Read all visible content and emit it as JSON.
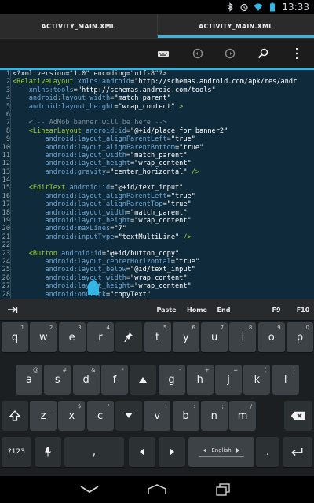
{
  "status": {
    "time": "13:33"
  },
  "tabs": [
    {
      "label": "ACTIVITY_MAIN.XML",
      "active": false
    },
    {
      "label": "ACTIVITY_MAIN.XML",
      "active": true
    }
  ],
  "code_lines": [
    {
      "n": "1",
      "segs": [
        [
          "norm",
          "<?xml version=\"1.0\" encoding=\"utf-8\"?>"
        ]
      ]
    },
    {
      "n": "2",
      "segs": [
        [
          "tag",
          "<RelativeLayout "
        ],
        [
          "attr",
          "xmlns:android"
        ],
        [
          "punc",
          "="
        ],
        [
          "str",
          "\"http://schemas.android.com/apk/res/andr"
        ]
      ]
    },
    {
      "n": "3",
      "segs": [
        [
          "norm",
          "    "
        ],
        [
          "attr",
          "xmlns:tools"
        ],
        [
          "punc",
          "="
        ],
        [
          "str",
          "\"http://schemas.android.com/tools\""
        ]
      ]
    },
    {
      "n": "4",
      "segs": [
        [
          "norm",
          "    "
        ],
        [
          "attr",
          "android:layout_width"
        ],
        [
          "punc",
          "="
        ],
        [
          "str",
          "\"match_parent\""
        ]
      ]
    },
    {
      "n": "5",
      "segs": [
        [
          "norm",
          "    "
        ],
        [
          "attr",
          "android:layout_height"
        ],
        [
          "punc",
          "="
        ],
        [
          "str",
          "\"wrap_content\""
        ],
        [
          "tag",
          " >"
        ]
      ]
    },
    {
      "n": "6",
      "segs": []
    },
    {
      "n": "7",
      "segs": [
        [
          "norm",
          "    "
        ],
        [
          "com",
          "<!-- AdMob banner will be here -->"
        ]
      ]
    },
    {
      "n": "8",
      "segs": [
        [
          "norm",
          "    "
        ],
        [
          "tag",
          "<LinearLayout "
        ],
        [
          "attr",
          "android:id"
        ],
        [
          "punc",
          "="
        ],
        [
          "str",
          "\"@+id/place_for_banner2\""
        ]
      ]
    },
    {
      "n": "9",
      "segs": [
        [
          "norm",
          "        "
        ],
        [
          "attr",
          "android:layout_alignParentLeft"
        ],
        [
          "punc",
          "="
        ],
        [
          "str",
          "\"true\""
        ]
      ]
    },
    {
      "n": "10",
      "segs": [
        [
          "norm",
          "        "
        ],
        [
          "attr",
          "android:layout_alignParentBottom"
        ],
        [
          "punc",
          "="
        ],
        [
          "str",
          "\"true\""
        ]
      ]
    },
    {
      "n": "11",
      "segs": [
        [
          "norm",
          "        "
        ],
        [
          "attr",
          "android:layout_width"
        ],
        [
          "punc",
          "="
        ],
        [
          "str",
          "\"match_parent\""
        ]
      ]
    },
    {
      "n": "12",
      "segs": [
        [
          "norm",
          "        "
        ],
        [
          "attr",
          "android:layout_height"
        ],
        [
          "punc",
          "="
        ],
        [
          "str",
          "\"wrap_content\""
        ]
      ]
    },
    {
      "n": "13",
      "segs": [
        [
          "norm",
          "        "
        ],
        [
          "attr",
          "android:gravity"
        ],
        [
          "punc",
          "="
        ],
        [
          "str",
          "\"center_horizontal\""
        ],
        [
          "tag",
          " />"
        ]
      ]
    },
    {
      "n": "14",
      "segs": []
    },
    {
      "n": "15",
      "segs": [
        [
          "norm",
          "    "
        ],
        [
          "tag",
          "<EditText "
        ],
        [
          "attr",
          "android:id"
        ],
        [
          "punc",
          "="
        ],
        [
          "str",
          "\"@+id/text_input\""
        ]
      ]
    },
    {
      "n": "16",
      "segs": [
        [
          "norm",
          "        "
        ],
        [
          "attr",
          "android:layout_alignParentLeft"
        ],
        [
          "punc",
          "="
        ],
        [
          "str",
          "\"true\""
        ]
      ]
    },
    {
      "n": "17",
      "segs": [
        [
          "norm",
          "        "
        ],
        [
          "attr",
          "android:layout_alignParentTop"
        ],
        [
          "punc",
          "="
        ],
        [
          "str",
          "\"true\""
        ]
      ]
    },
    {
      "n": "18",
      "segs": [
        [
          "norm",
          "        "
        ],
        [
          "attr",
          "android:layout_width"
        ],
        [
          "punc",
          "="
        ],
        [
          "str",
          "\"match_parent\""
        ]
      ]
    },
    {
      "n": "19",
      "segs": [
        [
          "norm",
          "        "
        ],
        [
          "attr",
          "android:layout_height"
        ],
        [
          "punc",
          "="
        ],
        [
          "str",
          "\"wrap_content\""
        ]
      ]
    },
    {
      "n": "20",
      "segs": [
        [
          "norm",
          "        "
        ],
        [
          "attr",
          "android:maxLines"
        ],
        [
          "punc",
          "="
        ],
        [
          "str",
          "\"7\""
        ]
      ]
    },
    {
      "n": "21",
      "segs": [
        [
          "norm",
          "        "
        ],
        [
          "attr",
          "android:inputType"
        ],
        [
          "punc",
          "="
        ],
        [
          "str",
          "\"textMultiLine\""
        ],
        [
          "tag",
          " />"
        ]
      ]
    },
    {
      "n": "22",
      "segs": []
    },
    {
      "n": "23",
      "segs": [
        [
          "norm",
          "    "
        ],
        [
          "tag",
          "<Button "
        ],
        [
          "attr",
          "android:id"
        ],
        [
          "punc",
          "="
        ],
        [
          "str",
          "\"@+id/button_copy\""
        ]
      ]
    },
    {
      "n": "24",
      "segs": [
        [
          "norm",
          "        "
        ],
        [
          "attr",
          "android:layout_centerHorizontal"
        ],
        [
          "punc",
          "="
        ],
        [
          "str",
          "\"true\""
        ]
      ]
    },
    {
      "n": "25",
      "segs": [
        [
          "norm",
          "        "
        ],
        [
          "attr",
          "android:layout_below"
        ],
        [
          "punc",
          "="
        ],
        [
          "str",
          "\"@id/text_input\""
        ]
      ]
    },
    {
      "n": "26",
      "segs": [
        [
          "norm",
          "        "
        ],
        [
          "attr",
          "android:layout_width"
        ],
        [
          "punc",
          "="
        ],
        [
          "str",
          "\"wrap_content\""
        ]
      ]
    },
    {
      "n": "27",
      "segs": [
        [
          "norm",
          "        "
        ],
        [
          "attr",
          "android:layout_height"
        ],
        [
          "punc",
          "="
        ],
        [
          "str",
          "\"wrap_content\""
        ]
      ]
    },
    {
      "n": "28",
      "segs": [
        [
          "norm",
          "        "
        ],
        [
          "attr",
          "android:onClick"
        ],
        [
          "punc",
          "="
        ],
        [
          "str",
          "\"copyText\""
        ]
      ]
    }
  ],
  "keyboard": {
    "toolbar": {
      "paste": "Paste",
      "home": "Home",
      "end": "End",
      "f9": "F9",
      "f10": "F10"
    },
    "row1": [
      {
        "k": "q",
        "s": "1"
      },
      {
        "k": "w",
        "s": "2"
      },
      {
        "k": "e",
        "s": "3"
      },
      {
        "k": "r",
        "s": "4"
      },
      {
        "k": "pin",
        "s": ""
      },
      {
        "k": "t",
        "s": "5"
      },
      {
        "k": "y",
        "s": "6"
      },
      {
        "k": "u",
        "s": "7"
      },
      {
        "k": "i",
        "s": "8"
      },
      {
        "k": "o",
        "s": "9"
      },
      {
        "k": "p",
        "s": "0"
      }
    ],
    "row2": [
      {
        "k": "a",
        "s": "@"
      },
      {
        "k": "s",
        "s": "#"
      },
      {
        "k": "d",
        "s": "&"
      },
      {
        "k": "f",
        "s": "*"
      },
      {
        "k": "up",
        "s": ""
      },
      {
        "k": "g",
        "s": "-"
      },
      {
        "k": "h",
        "s": "+"
      },
      {
        "k": "j",
        "s": "="
      },
      {
        "k": "k",
        "s": "("
      },
      {
        "k": "l",
        "s": ")"
      }
    ],
    "row3": [
      {
        "k": "shift",
        "s": ""
      },
      {
        "k": "z",
        "s": "_"
      },
      {
        "k": "x",
        "s": "$"
      },
      {
        "k": "c",
        "s": "\""
      },
      {
        "k": "down",
        "s": ""
      },
      {
        "k": "v",
        "s": "'"
      },
      {
        "k": "b",
        "s": ":"
      },
      {
        "k": "n",
        "s": ";"
      },
      {
        "k": "m",
        "s": "/"
      },
      {
        "k": "del",
        "s": ""
      }
    ],
    "sym_label": "?123",
    "space_label": "English",
    "period": ".",
    "comma": ","
  },
  "colors": {
    "accent": "#33b5e5",
    "editor_bg": "#0f2b3b",
    "tag": "#9acd32",
    "attr": "#6aa7d8",
    "comment": "#7a8a96"
  }
}
